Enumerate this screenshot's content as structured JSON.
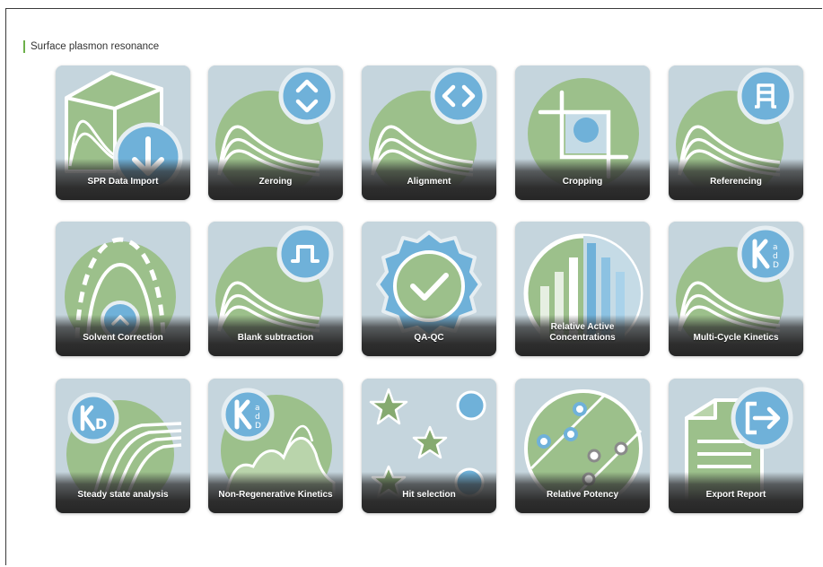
{
  "section": {
    "title": "Surface plasmon resonance"
  },
  "colors": {
    "tile_bg": "#c5d5dd",
    "green": "#9cc08b",
    "blue": "#6fb1d9",
    "white": "#ffffff",
    "footer": "#2e2e2e",
    "section_bar": "#6db04a"
  },
  "tiles": [
    {
      "label": "SPR Data Import",
      "icon": "download-icon"
    },
    {
      "label": "Zeroing",
      "icon": "up-down-chevron-icon"
    },
    {
      "label": "Alignment",
      "icon": "left-right-chevron-icon"
    },
    {
      "label": "Cropping",
      "icon": "crop-icon"
    },
    {
      "label": "Referencing",
      "icon": "reference-pulse-icon"
    },
    {
      "label": "Solvent Correction",
      "icon": "solvent-arch-icon"
    },
    {
      "label": "Blank subtraction",
      "icon": "square-pulse-icon"
    },
    {
      "label": "QA-QC",
      "icon": "badge-check-icon"
    },
    {
      "label": "Relative Active\nConcentrations",
      "icon": "bars-icon"
    },
    {
      "label": "Multi-Cycle Kinetics",
      "icon": "kinetics-k-icon"
    },
    {
      "label": "Steady state analysis",
      "icon": "kd-icon"
    },
    {
      "label": "Non-Regenerative Kinetics",
      "icon": "kinetics-k-icon"
    },
    {
      "label": "Hit selection",
      "icon": "stars-circles-icon"
    },
    {
      "label": "Relative Potency",
      "icon": "potency-lines-icon"
    },
    {
      "label": "Export Report",
      "icon": "export-icon"
    }
  ]
}
